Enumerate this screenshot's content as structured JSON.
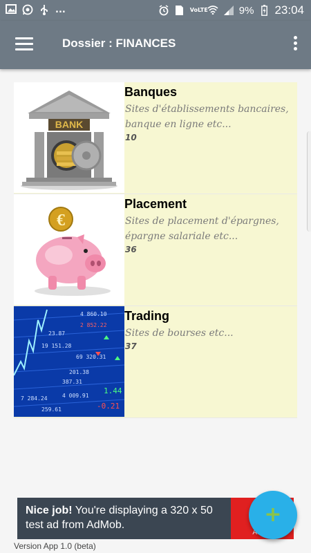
{
  "statusbar": {
    "left_icons": [
      "image-icon",
      "whatsapp-icon",
      "usb-icon",
      "more-notifications"
    ],
    "overflow_dots": "...",
    "volte": "VoLTE",
    "battery": "9%",
    "time": "23:04"
  },
  "appbar": {
    "title": "Dossier : FINANCES"
  },
  "folders": [
    {
      "title": "Banques",
      "description": "Sites d'établissements bancaires, banque en ligne etc...",
      "count": "10",
      "bank_sign": "BANK"
    },
    {
      "title": "Placement",
      "description": "Sites de placement d'épargnes, épargne salariale etc...",
      "count": "36",
      "coin_symbol": "€"
    },
    {
      "title": "Trading",
      "description": "Sites de bourses etc...",
      "count": "37",
      "ticker_values": [
        "4 860.10",
        "2 852.22",
        "23.87",
        "19 151.28",
        "69 320.31",
        "201.38",
        "387.31",
        "4 009.91",
        "1.44",
        "-0.21",
        "7 284.24",
        "259.61"
      ]
    }
  ],
  "ad": {
    "bold": "Nice job!",
    "text": " You're displaying a 320 x 50 test ad from AdMob.",
    "brand": "AdMob"
  },
  "fab": {
    "label": "+"
  },
  "footer": {
    "version": "Version App 1.0 (beta)"
  },
  "colors": {
    "appbar": "#6e7a85",
    "row_background": "#f7f7d2",
    "fab": "#29b0e8",
    "fab_plus": "#8bc34a",
    "ad_background": "#3b4652",
    "ad_accent": "#e02020"
  }
}
